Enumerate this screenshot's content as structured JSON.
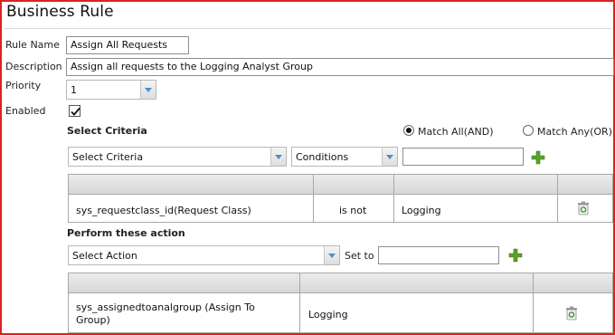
{
  "page": {
    "title": "Business Rule"
  },
  "rule_name": {
    "label": "Rule Name",
    "value": "Assign All Requests"
  },
  "description": {
    "label": "Description",
    "value": "Assign all requests to the Logging Analyst Group"
  },
  "priority": {
    "label": "Priority",
    "value": "1"
  },
  "enabled": {
    "label": "Enabled",
    "checked": true
  },
  "criteria": {
    "heading": "Select Criteria",
    "match_all_label": "Match All(AND)",
    "match_any_label": "Match Any(OR)",
    "match_selected": "all",
    "field_select": "Select Criteria",
    "condition_select": "Conditions",
    "value_input": "",
    "rows": [
      {
        "field": "sys_requestclass_id(Request Class)",
        "condition": "is not",
        "value": "Logging"
      }
    ]
  },
  "actions": {
    "heading": "Perform these action",
    "action_select": "Select Action",
    "set_to_label": "Set to",
    "set_to_input": "",
    "rows": [
      {
        "field_line1": "sys_assignedtoanalgroup (Assign To",
        "field_line2": "Group)",
        "value": "Logging"
      }
    ]
  },
  "colors": {
    "frame": "#e02020",
    "accent_plus": "#5aa02c",
    "dropdown_arrow": "#4a8fd0"
  }
}
